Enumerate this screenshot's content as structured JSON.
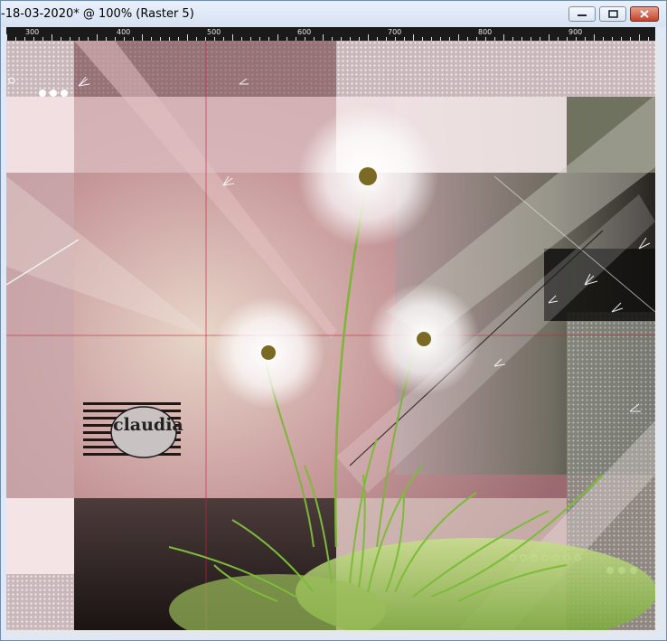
{
  "window": {
    "title": "-18-03-2020* @ 100% (Raster 5)",
    "minimize_icon": "minimize-icon",
    "maximize_icon": "maximize-icon",
    "close_icon": "close-icon"
  },
  "ruler": {
    "labels": [
      "300",
      "400",
      "500",
      "600",
      "700",
      "800",
      "900"
    ]
  },
  "canvas": {
    "watermark_text": "claudia",
    "colors": {
      "pink_dark": "#8c4e57",
      "pink_light": "#f3e2e4",
      "mauve": "#b58d91",
      "olive_dark": "#3c4231",
      "grass": "#8ec64a",
      "guide_red": "#c0283a"
    }
  }
}
